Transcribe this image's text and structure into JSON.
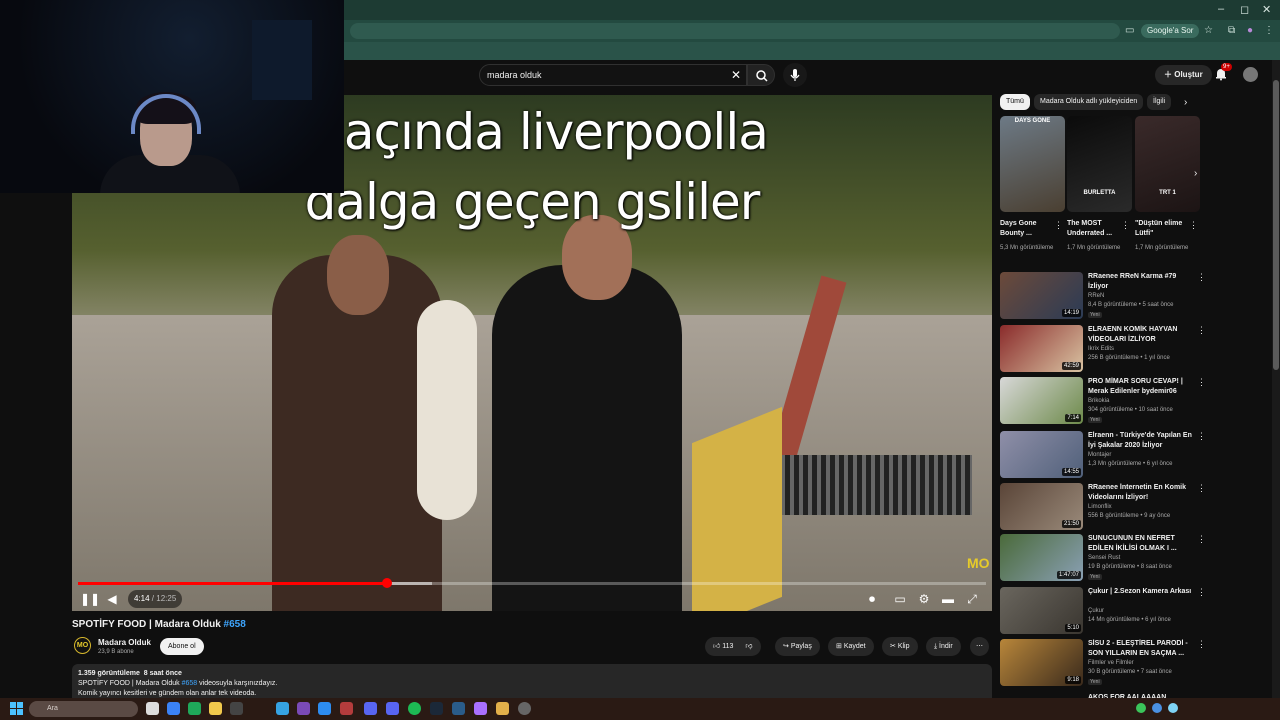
{
  "browser": {
    "window_controls": [
      "–",
      "◻",
      "✕"
    ],
    "google_sor": "Google'a Sor"
  },
  "header": {
    "search_value": "madara olduk",
    "create_label": "Oluştur",
    "notif_badge": "9+"
  },
  "player": {
    "caption_line1": "maçında liverpoolla",
    "caption_line2": "dalga geçen gsliler",
    "watermark": "MO",
    "time_current": "4:14",
    "time_sep": " / ",
    "time_total": "12:25",
    "progress_fraction": 0.34,
    "buffer_fraction": 0.39
  },
  "video": {
    "title": "SPOTİFY FOOD | Madara Olduk",
    "episode_tag": "#658",
    "channel_name": "Madara Olduk",
    "channel_logo": "MO",
    "channel_subs": "23,9 B abone",
    "subscribe_label": "Abone ol",
    "like_count": "113",
    "share_label": "Paylaş",
    "save_label": "Kaydet",
    "clip_label": "Klip",
    "download_label": "İndir",
    "desc_views": "1.359 görüntüleme",
    "desc_age": "8 saat önce",
    "desc_line2_pre": "SPOTİFY FOOD | Madara Olduk",
    "desc_line2_tag": "#658",
    "desc_line2_post": "videosuyla karşınızdayız.",
    "desc_line3": "Komik yayıncı kesitleri ve gündem olan anlar tek videoda."
  },
  "sidebar": {
    "chips": [
      "Tümü",
      "Madara Olduk adlı yükleyiciden",
      "İlgili"
    ],
    "shorts": [
      {
        "title": "Days Gone Bounty ...",
        "views": "5,3 Mn görüntüleme",
        "overlay": "DAYS GONE",
        "color_a": "#6d7a86",
        "color_b": "#4a3f31"
      },
      {
        "title": "The MOST Underrated ...",
        "views": "1,7 Mn görüntüleme",
        "overlay": "BURLETTA",
        "color_a": "#0b0b0b",
        "color_b": "#2a2a2a"
      },
      {
        "title": "\"Düştün elime Lütfi\"",
        "views": "1,7 Mn görüntüleme",
        "overlay": "TRT 1",
        "color_a": "#3a2a2a",
        "color_b": "#1c1414"
      }
    ],
    "recs": [
      {
        "title": "RRaenee RReN Karma #79 İzliyor",
        "channel": "RReN",
        "views": "8,4 B görüntüleme • 5 saat önce",
        "duration": "14:19",
        "new": "Yeni",
        "color_a": "#6c4a3a",
        "color_b": "#2b3b55"
      },
      {
        "title": "ELRAENN KOMİK HAYVAN VİDEOLARI İZLİYOR",
        "channel": "Ikrix Edits",
        "views": "256 B görüntüleme • 1 yıl önce",
        "duration": "42:59",
        "new": "",
        "color_a": "#8a2b2b",
        "color_b": "#d9c3a2"
      },
      {
        "title": "PRO MİMAR SORU CEVAP! | Merak Edilenler bydemir06",
        "channel": "Brikokia",
        "views": "304 görüntüleme • 10 saat önce",
        "duration": "7:14",
        "new": "Yeni",
        "color_a": "#d8d8d8",
        "color_b": "#6d8a4a"
      },
      {
        "title": "Elraenn - Türkiye'de Yapılan En İyi Şakalar 2020 İzliyor",
        "channel": "Montajer",
        "views": "1,3 Mn görüntüleme • 6 yıl önce",
        "duration": "14:55",
        "new": "",
        "color_a": "#8f8fa8",
        "color_b": "#50607a"
      },
      {
        "title": "RRaenee İnternetin En Komik Videolarını İzliyor!",
        "channel": "Limonflix",
        "views": "556 B görüntüleme • 9 ay önce",
        "duration": "21:50",
        "new": "",
        "color_a": "#5a4538",
        "color_b": "#9a8a7a"
      },
      {
        "title": "SUNUCUNUN EN NEFRET EDİLEN İKİLİSİ OLMAK I ...",
        "channel": "Sensei Rust",
        "views": "19 B görüntüleme • 8 saat önce",
        "duration": "1:47:07",
        "new": "Yeni",
        "color_a": "#4a6a3a",
        "color_b": "#8aa0b4"
      },
      {
        "title": "Çukur | 2.Sezon Kamera Arkası",
        "channel": "Çukur",
        "views": "14 Mn görüntüleme • 6 yıl önce",
        "duration": "5:10",
        "new": "",
        "color_a": "#6a665e",
        "color_b": "#3a3630"
      },
      {
        "title": "SİSU 2 - ELEŞTİREL PARODİ - SON YILLARIN EN SAÇMA ...",
        "channel": "Filmler ve Filmler",
        "views": "30 B görüntüleme • 7 saat önce",
        "duration": "9:18",
        "new": "Yeni",
        "color_a": "#b8863a",
        "color_b": "#3a2a1c"
      }
    ],
    "partial_title": "AKOS FOR AALAAAAN"
  },
  "taskbar": {
    "search_placeholder": "Ara"
  },
  "colors": {
    "accent_red": "#ff0000",
    "link_blue": "#3ea6ff",
    "bg": "#0f0f0f",
    "chrome_green": "#234a40"
  }
}
